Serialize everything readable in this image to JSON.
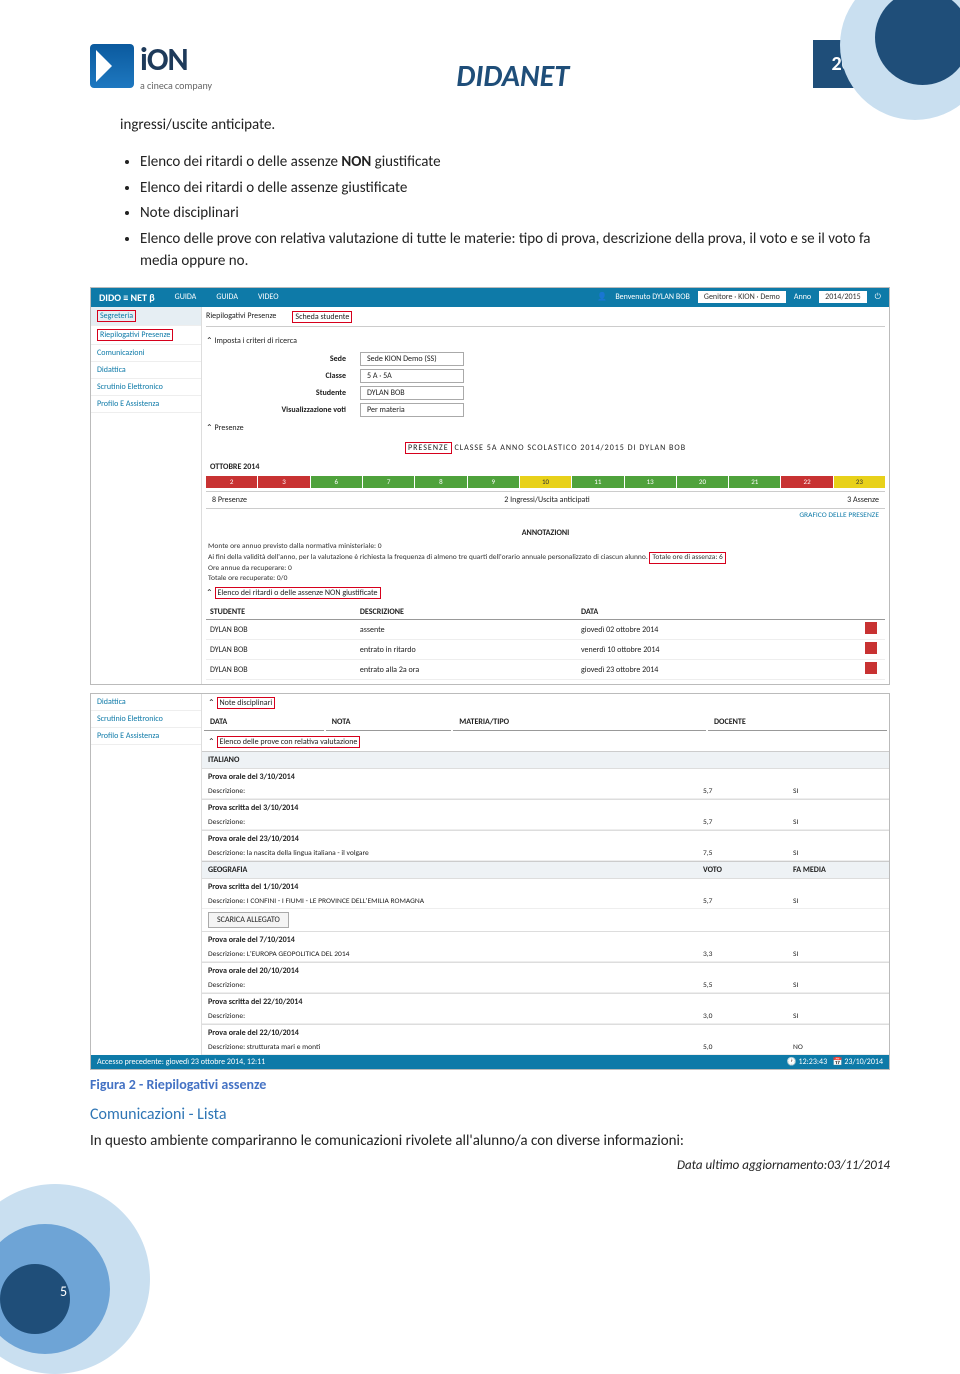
{
  "header": {
    "logo_name": "iON",
    "logo_sub": "a cineca company",
    "title": "DIDANET",
    "year": "2014"
  },
  "body": {
    "lead": "ingressi/uscite anticipate.",
    "bullets": [
      {
        "pre": "Elenco dei ritardi o delle assenze ",
        "strong": "NON",
        "post": " giustificate"
      },
      {
        "text": "Elenco dei ritardi o delle assenze  giustificate"
      },
      {
        "text": "Note disciplinari"
      },
      {
        "text": "Elenco delle prove con relativa valutazione di tutte le materie: tipo di prova, descrizione della prova, il voto  e se il voto fa media oppure no."
      }
    ]
  },
  "app": {
    "brand": "DIDO ≡ NET β",
    "menu_guida": "GUIDA",
    "menu_video": "VIDEO",
    "welcome": "Benvenuto DYLAN BOB",
    "profile": "Genitore · KION · Demo",
    "anno_label": "Anno",
    "anno_val": "2014/2015",
    "side": {
      "segreteria": "Segreteria",
      "riep_presenze": "Riepilogativi Presenze",
      "comunicazioni": "Comunicazioni",
      "didattica": "Didattica",
      "scrutinio": "Scrutinio Elettronico",
      "profilo": "Profilo E Assistenza"
    },
    "tabs": {
      "riep": "Riepilogativi Presenze",
      "scheda": "Scheda studente"
    },
    "criteri": {
      "title": "Imposta i criteri di ricerca",
      "sede_l": "Sede",
      "sede_v": "Sede KION Demo (SS)",
      "classe_l": "Classe",
      "classe_v": "5 A · 5A",
      "studente_l": "Studente",
      "studente_v": "DYLAN BOB",
      "vis_l": "Visualizzazione voti",
      "vis_v": "Per materia"
    },
    "presenze": {
      "section": "Presenze",
      "heading_pre": "PRESENZE",
      "heading_rest": " CLASSE 5A ANNO SCOLASTICO 2014/2015 DI DYLAN BOB",
      "ottobre": "OTTOBRE 2014",
      "days": [
        "2",
        "3",
        "6",
        "7",
        "8",
        "9",
        "10",
        "11",
        "13",
        "20",
        "21",
        "22",
        "23"
      ],
      "day_colors": [
        "d-red",
        "d-red",
        "d-green",
        "d-green",
        "d-green",
        "d-green",
        "d-yellow",
        "d-green",
        "d-green",
        "d-green",
        "d-green",
        "d-red",
        "d-yellow"
      ],
      "s_presenze": "8 Presenze",
      "s_ingressi": "2 Ingressi/Uscita anticipati",
      "s_assenze": "3 Assenze",
      "grafico": "GRAFICO DELLE PRESENZE"
    },
    "annot": {
      "title": "ANNOTAZIONI",
      "l1": "Monte ore annuo previsto dalla normativa ministeriale: 0",
      "l2_pre": "Ai fini della validità dell'anno, per la valutazione è richiesta la frequenza di almeno tre quarti dell'orario annuale personalizzato di ciascun alunno. ",
      "l2_box": "Totale ore di assenza: 6",
      "l3": "Ore annue da recuperare: 0",
      "l4": "Totale ore recuperate: 0/0"
    },
    "elenco": {
      "title": "Elenco dei ritardi o delle assenze NON giustificate",
      "h_stud": "STUDENTE",
      "h_desc": "DESCRIZIONE",
      "h_data": "DATA",
      "rows": [
        {
          "s": "DYLAN BOB",
          "d": "assente",
          "t": "giovedì 02 ottobre 2014"
        },
        {
          "s": "DYLAN BOB",
          "d": "entrato in ritardo",
          "t": "venerdì 10 ottobre 2014"
        },
        {
          "s": "DYLAN BOB",
          "d": "entrato alla 2a ora",
          "t": "giovedì 23 ottobre 2014"
        }
      ]
    }
  },
  "app2": {
    "side": {
      "didattica": "Didattica",
      "scrutinio": "Scrutinio Elettronico",
      "profilo": "Profilo E Assistenza"
    },
    "note": {
      "title": "Note disciplinari",
      "h_data": "DATA",
      "h_nota": "NOTA",
      "h_materia": "MATERIA/TIPO",
      "h_docente": "DOCENTE"
    },
    "elenco_prove": "Elenco delle prove con relativa valutazione",
    "h_voto": "VOTO",
    "h_media": "FA MEDIA",
    "italiano": "ITALIANO",
    "geografia": "GEOGRAFIA",
    "scarica": "SCARICA ALLEGATO",
    "prove_it": [
      {
        "h": "Prova orale del 3/10/2014",
        "d": "Descrizione:",
        "v": "5,7",
        "m": "SI"
      },
      {
        "h": "Prova scritta del 3/10/2014",
        "d": "Descrizione:",
        "v": "5,7",
        "m": "SI"
      },
      {
        "h": "Prova orale del 23/10/2014",
        "d": "Descrizione: la nascita della lingua italiana - il volgare",
        "v": "7,5",
        "m": "SI"
      }
    ],
    "prove_geo": [
      {
        "h": "Prova scritta del 1/10/2014",
        "d": "Descrizione: I CONFINI - I FIUMI - LE PROVINCE DELL'EMILIA ROMAGNA",
        "v": "5,7",
        "m": "SI"
      },
      {
        "h": "Prova orale del 7/10/2014",
        "d": "Descrizione: L'EUROPA GEOPOLITICA DEL 2014",
        "v": "3,3",
        "m": "SI"
      },
      {
        "h": "Prova orale del 20/10/2014",
        "d": "Descrizione:",
        "v": "5,5",
        "m": "SI"
      },
      {
        "h": "Prova scritta del 22/10/2014",
        "d": "Descrizione:",
        "v": "3,0",
        "m": "SI"
      },
      {
        "h": "Prova orale del 22/10/2014",
        "d": "Descrizione: strutturata mari e monti",
        "v": "5,0",
        "m": "NO"
      }
    ],
    "footer_left": "Accesso precedente: giovedì 23 ottobre 2014, 12:11",
    "footer_time": "12:23:43",
    "footer_date": "23/10/2014"
  },
  "caption": "Figura 2 - Riepilogativi assenze",
  "section_heading": "Comunicazioni - Lista",
  "last_para": "In questo ambiente compariranno le comunicazioni rivolete all'alunno/a con diverse informazioni:",
  "footer_line": "Data ultimo aggiornamento:03/11/2014",
  "pagenum": "5"
}
